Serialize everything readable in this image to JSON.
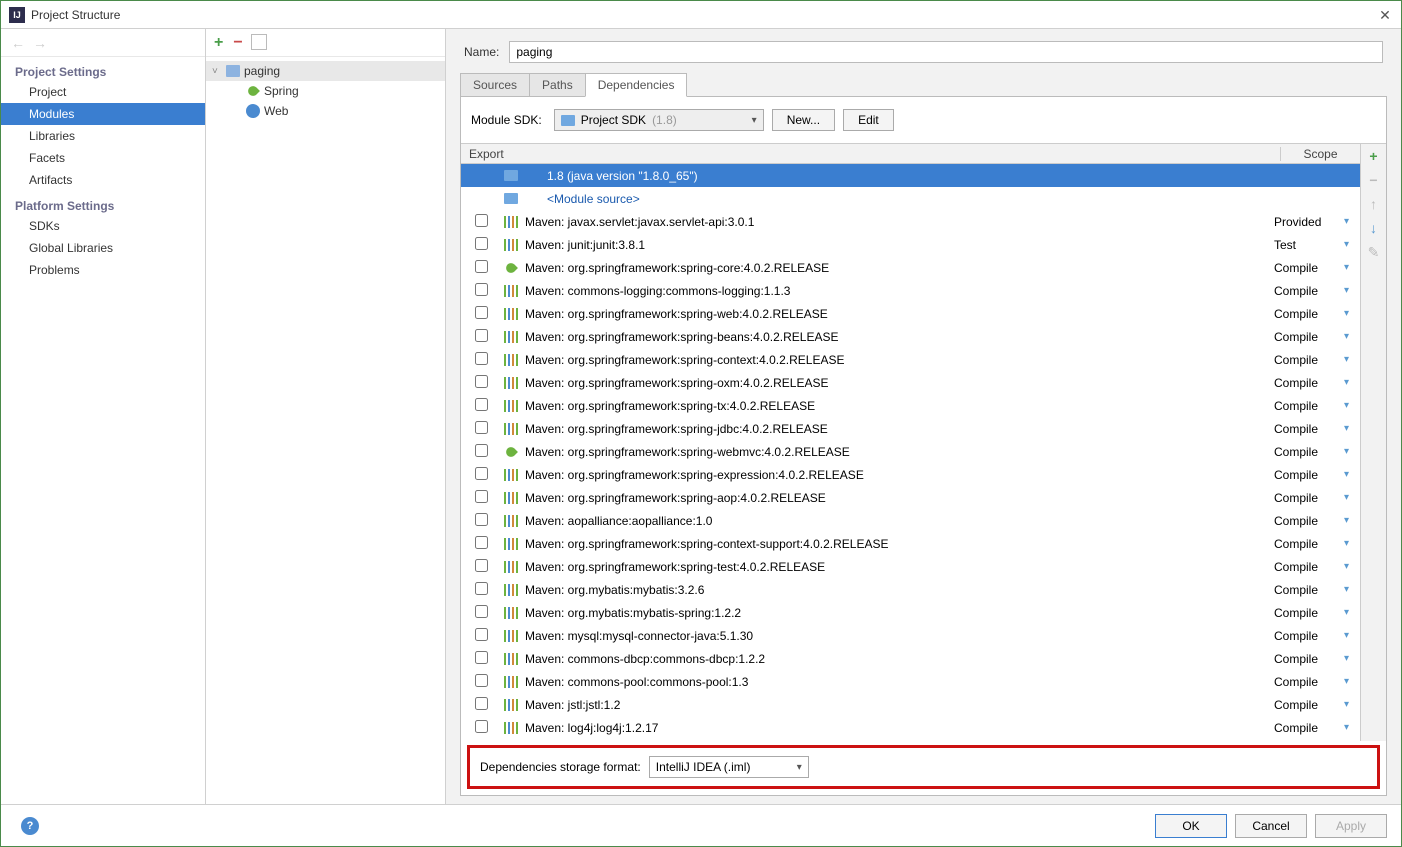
{
  "window": {
    "title": "Project Structure"
  },
  "sidebar": {
    "sections": [
      {
        "title": "Project Settings",
        "items": [
          "Project",
          "Modules",
          "Libraries",
          "Facets",
          "Artifacts"
        ],
        "selected": 1
      },
      {
        "title": "Platform Settings",
        "items": [
          "SDKs",
          "Global Libraries"
        ]
      },
      {
        "title": "",
        "items": [
          "Problems"
        ]
      }
    ]
  },
  "tree": {
    "root": "paging",
    "children": [
      "Spring",
      "Web"
    ]
  },
  "main": {
    "name_label": "Name:",
    "name_value": "paging",
    "tabs": [
      "Sources",
      "Paths",
      "Dependencies"
    ],
    "active_tab": 2,
    "sdk_label": "‎Module SDK:",
    "sdk_value": "Project SDK",
    "sdk_suffix": "(1.8)",
    "btn_new": "New...",
    "btn_edit": "Edit",
    "head_export": "Export",
    "head_scope": "Scope",
    "rows": [
      {
        "type": "jdk",
        "label": "1.8 (java version \"1.8.0_65\")",
        "scope": "",
        "selected": true,
        "chk": false
      },
      {
        "type": "src",
        "label": "<Module source>",
        "scope": "",
        "chk": false
      },
      {
        "type": "lib",
        "label": "Maven: javax.servlet:javax.servlet-api:3.0.1",
        "scope": "Provided",
        "chk": true
      },
      {
        "type": "lib",
        "label": "Maven: junit:junit:3.8.1",
        "scope": "Test",
        "chk": true
      },
      {
        "type": "spring",
        "label": "Maven: org.springframework:spring-core:4.0.2.RELEASE",
        "scope": "Compile",
        "chk": true
      },
      {
        "type": "lib",
        "label": "Maven: commons-logging:commons-logging:1.1.3",
        "scope": "Compile",
        "chk": true
      },
      {
        "type": "lib",
        "label": "Maven: org.springframework:spring-web:4.0.2.RELEASE",
        "scope": "Compile",
        "chk": true
      },
      {
        "type": "lib",
        "label": "Maven: org.springframework:spring-beans:4.0.2.RELEASE",
        "scope": "Compile",
        "chk": true
      },
      {
        "type": "lib",
        "label": "Maven: org.springframework:spring-context:4.0.2.RELEASE",
        "scope": "Compile",
        "chk": true
      },
      {
        "type": "lib",
        "label": "Maven: org.springframework:spring-oxm:4.0.2.RELEASE",
        "scope": "Compile",
        "chk": true
      },
      {
        "type": "lib",
        "label": "Maven: org.springframework:spring-tx:4.0.2.RELEASE",
        "scope": "Compile",
        "chk": true
      },
      {
        "type": "lib",
        "label": "Maven: org.springframework:spring-jdbc:4.0.2.RELEASE",
        "scope": "Compile",
        "chk": true
      },
      {
        "type": "spring",
        "label": "Maven: org.springframework:spring-webmvc:4.0.2.RELEASE",
        "scope": "Compile",
        "chk": true
      },
      {
        "type": "lib",
        "label": "Maven: org.springframework:spring-expression:4.0.2.RELEASE",
        "scope": "Compile",
        "chk": true
      },
      {
        "type": "lib",
        "label": "Maven: org.springframework:spring-aop:4.0.2.RELEASE",
        "scope": "Compile",
        "chk": true
      },
      {
        "type": "lib",
        "label": "Maven: aopalliance:aopalliance:1.0",
        "scope": "Compile",
        "chk": true
      },
      {
        "type": "lib",
        "label": "Maven: org.springframework:spring-context-support:4.0.2.RELEASE",
        "scope": "Compile",
        "chk": true
      },
      {
        "type": "lib",
        "label": "Maven: org.springframework:spring-test:4.0.2.RELEASE",
        "scope": "Compile",
        "chk": true
      },
      {
        "type": "lib",
        "label": "Maven: org.mybatis:mybatis:3.2.6",
        "scope": "Compile",
        "chk": true
      },
      {
        "type": "lib",
        "label": "Maven: org.mybatis:mybatis-spring:1.2.2",
        "scope": "Compile",
        "chk": true
      },
      {
        "type": "lib",
        "label": "Maven: mysql:mysql-connector-java:5.1.30",
        "scope": "Compile",
        "chk": true
      },
      {
        "type": "lib",
        "label": "Maven: commons-dbcp:commons-dbcp:1.2.2",
        "scope": "Compile",
        "chk": true
      },
      {
        "type": "lib",
        "label": "Maven: commons-pool:commons-pool:1.3",
        "scope": "Compile",
        "chk": true
      },
      {
        "type": "lib",
        "label": "Maven: jstl:jstl:1.2",
        "scope": "Compile",
        "chk": true
      },
      {
        "type": "lib",
        "label": "Maven: log4j:log4j:1.2.17",
        "scope": "Compile",
        "chk": true
      }
    ],
    "storage_label": "Dependencies storage format:",
    "storage_value": "IntelliJ IDEA (.iml)"
  },
  "footer": {
    "ok": "OK",
    "cancel": "Cancel",
    "apply": "Apply"
  }
}
